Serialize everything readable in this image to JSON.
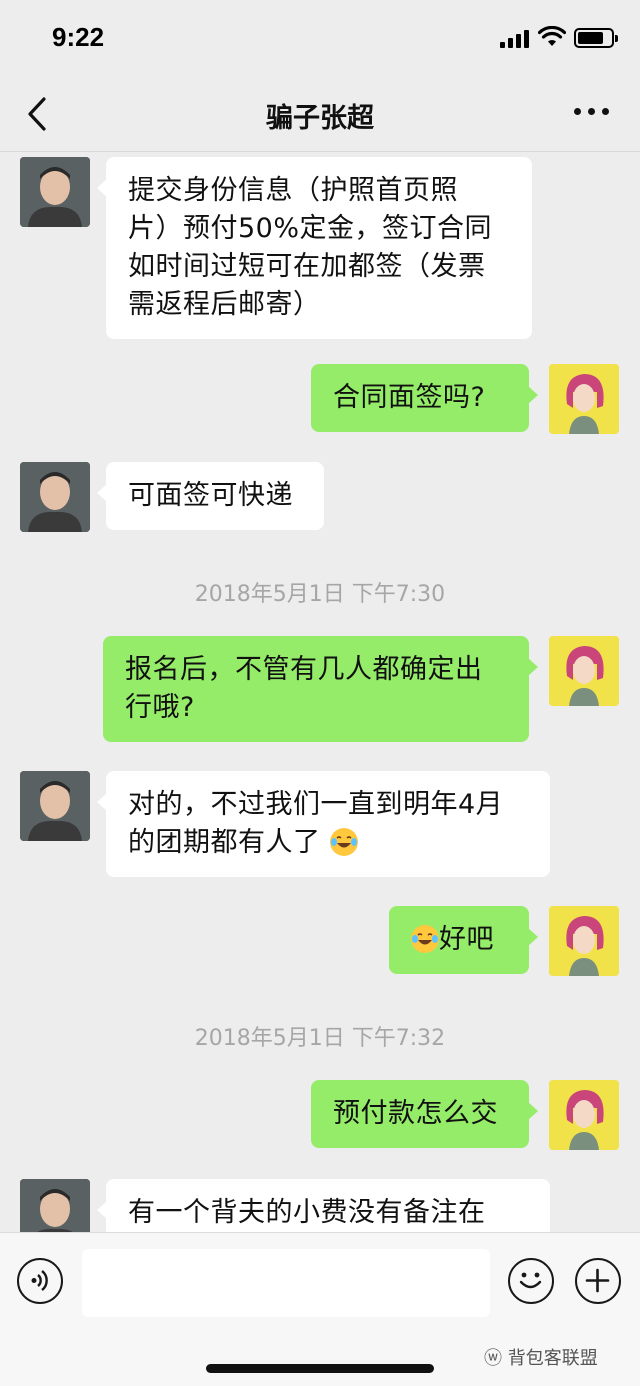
{
  "status_bar": {
    "time": "9:22"
  },
  "nav": {
    "title": "骗子张超"
  },
  "messages": [
    {
      "side": "left",
      "text": "提交身份信息（护照首页照片）预付50%定金，签订合同如时间过短可在加都签（发票需返程后邮寄）",
      "lines": [
        "提交身份信息（护照首页照",
        "片）预付50%定金，签订合同",
        "如时间过短可在加都签（发票",
        "需返程后邮寄）"
      ]
    },
    {
      "side": "right",
      "text": "合同面签吗?"
    },
    {
      "side": "left",
      "text": "可面签可快递"
    },
    {
      "timestamp": "2018年5月1日 下午7:30"
    },
    {
      "side": "right",
      "text": "报名后，不管有几人都确定出行哦?",
      "lines": [
        "报名后，不管有几人都确定出",
        "行哦?"
      ]
    },
    {
      "side": "left",
      "text": "对的，不过我们一直到明年4月的团期都有人了",
      "lines": [
        "对的，不过我们一直到明年4月",
        "的团期都有人了"
      ],
      "trailing_emoji": "laughing-tears-emoji"
    },
    {
      "side": "right",
      "text": "好吧",
      "leading_emoji": "laughing-tears-emoji"
    },
    {
      "timestamp": "2018年5月1日 下午7:32"
    },
    {
      "side": "right",
      "text": "预付款怎么交"
    },
    {
      "side": "left",
      "text": "有一个背夫的小费没有备注在"
    }
  ],
  "watermark": "背包客联盟",
  "colors": {
    "self_bubble": "#95ec69",
    "other_bubble": "#ffffff",
    "background": "#ededed"
  },
  "icons": {
    "voice": "voice-input-icon",
    "emoji": "emoji-icon",
    "plus": "plus-icon",
    "back": "back-chevron-icon",
    "more": "more-dots-icon"
  }
}
